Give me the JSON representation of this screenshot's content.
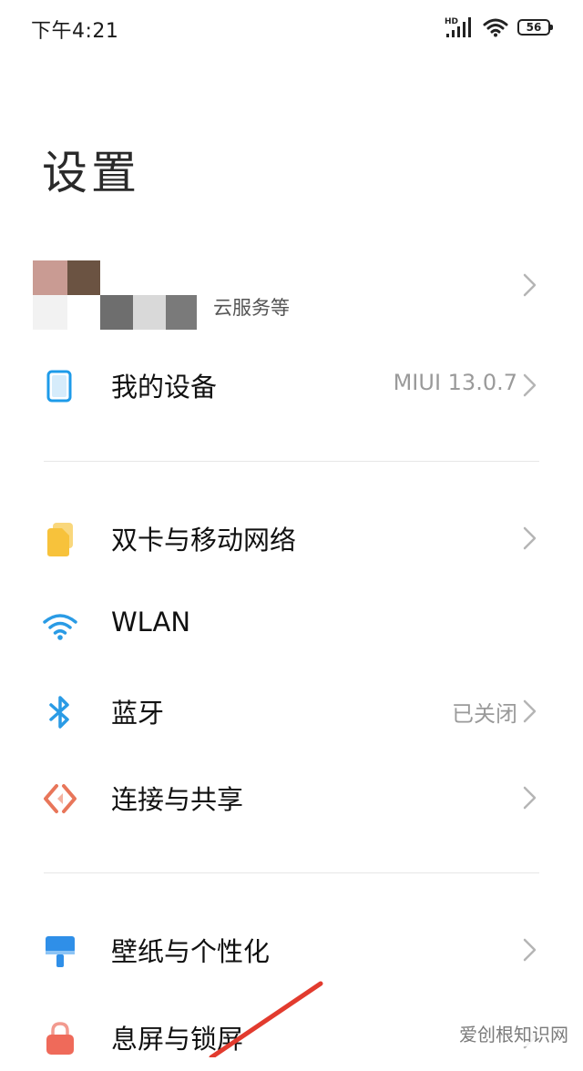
{
  "status_bar": {
    "time": "下午4:21",
    "network_label": "HD",
    "battery": "56",
    "icons": [
      "signal-icon",
      "wifi-icon",
      "battery-icon"
    ]
  },
  "page": {
    "title": "设置"
  },
  "account": {
    "subtitle": "云服务等"
  },
  "rows": {
    "my_device": {
      "label": "我的设备",
      "value": "MIUI 13.0.7"
    },
    "sim": {
      "label": "双卡与移动网络"
    },
    "wlan": {
      "label": "WLAN"
    },
    "bluetooth": {
      "label": "蓝牙",
      "value": "已关闭"
    },
    "connection": {
      "label": "连接与共享"
    },
    "wallpaper": {
      "label": "壁纸与个性化"
    },
    "lockscreen": {
      "label": "息屏与锁屏"
    }
  },
  "colors": {
    "device_icon": "#1e9be9",
    "sim_icon": "#f7c23b",
    "wlan_icon": "#2a9be5",
    "bluetooth_icon": "#2a9be5",
    "connection_icon": "#e8765a",
    "wallpaper_icon": "#2f8fe8",
    "lock_icon": "#ef6a5a",
    "annotation_arrow": "#e23b2e"
  },
  "watermark": "爱创根知识网"
}
